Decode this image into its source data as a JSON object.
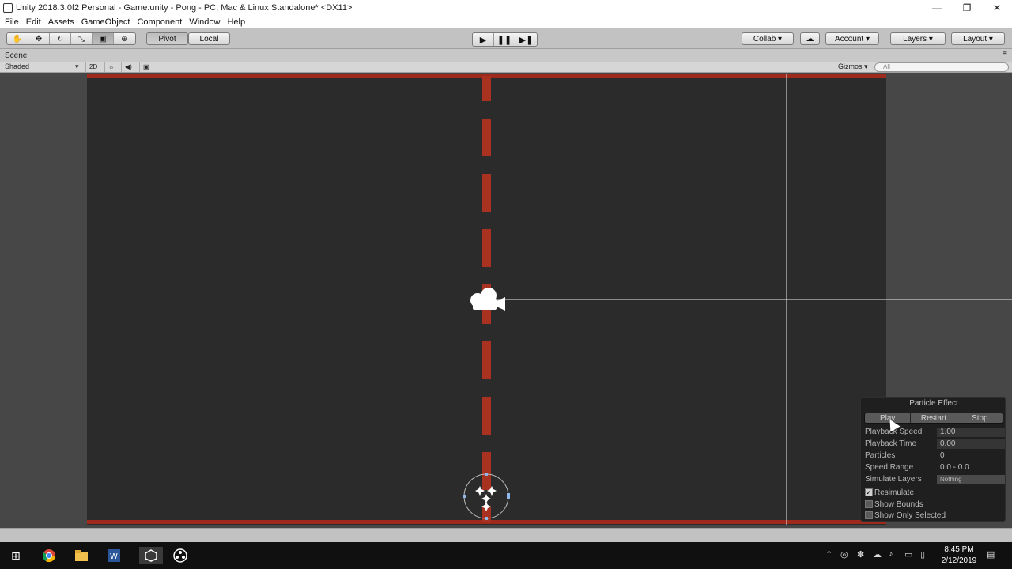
{
  "window": {
    "title": "Unity 2018.3.0f2 Personal - Game.unity - Pong - PC, Mac & Linux Standalone* <DX11>",
    "minimize": "—",
    "maximize": "❐",
    "close": "✕"
  },
  "menu": [
    "File",
    "Edit",
    "Assets",
    "GameObject",
    "Component",
    "Window",
    "Help"
  ],
  "toolbar": {
    "tools": [
      "hand-icon",
      "move-icon",
      "rotate-icon",
      "scale-icon",
      "rect-icon",
      "transform-icon"
    ],
    "pivot_label": "Pivot",
    "local_label": "Local",
    "play_label": "▶",
    "pause_label": "❚❚",
    "step_label": "▶❚",
    "collab_label": "Collab ▾",
    "cloud_label": "☁",
    "account_label": "Account ▾",
    "layers_label": "Layers ▾",
    "layout_label": "Layout ▾"
  },
  "scene": {
    "tab_label": "Scene",
    "menu_glyph": "≡",
    "shading_mode": "Shaded",
    "mode_2d": "2D",
    "light_glyph": "☼",
    "audio_glyph": "◀)",
    "effects_glyph": "▣",
    "gizmos_label": "Gizmos ▾",
    "search_placeholder": "All"
  },
  "particle_effect": {
    "title": "Particle Effect",
    "buttons": [
      "Play",
      "Restart",
      "Stop"
    ],
    "playback_speed_label": "Playback Speed",
    "playback_speed": "1.00",
    "playback_time_label": "Playback Time",
    "playback_time": "0.00",
    "particles_label": "Particles",
    "particles": "0",
    "speed_range_label": "Speed Range",
    "speed_range": "0.0 - 0.0",
    "simulate_layers_label": "Simulate Layers",
    "simulate_layers": "Nothing",
    "resimulate_label": "Resimulate",
    "resimulate": true,
    "show_bounds_label": "Show Bounds",
    "show_bounds": false,
    "show_only_selected_label": "Show Only Selected",
    "show_only_selected": false
  },
  "colors": {
    "wall": "#9e2a1e",
    "center_line": "#a8321f",
    "field_bg": "#1f1f1f",
    "viewport_bg": "#474747"
  },
  "taskbar": {
    "time": "8:45 PM",
    "date": "2/12/2019"
  }
}
